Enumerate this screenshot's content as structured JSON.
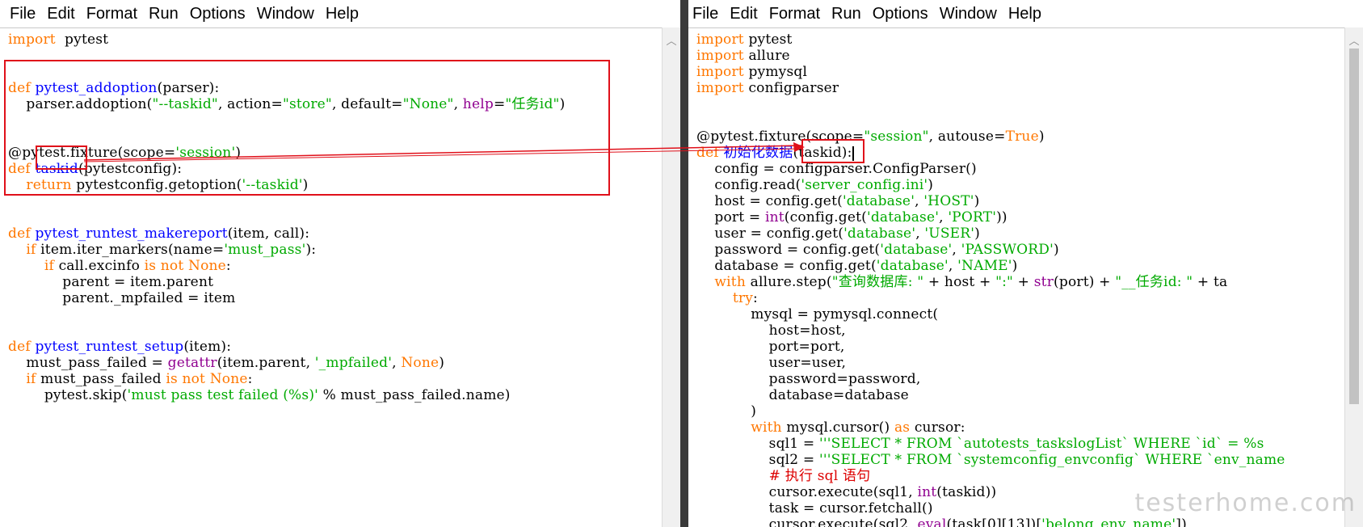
{
  "left_window": {
    "menu": [
      "File",
      "Edit",
      "Format",
      "Run",
      "Options",
      "Window",
      "Help"
    ],
    "code_lines": [
      [
        [
          "kw",
          "import"
        ],
        [
          "",
          "  pytest"
        ]
      ],
      [],
      [],
      [
        [
          "kw",
          "def"
        ],
        [
          "",
          " "
        ],
        [
          "def",
          "pytest_addoption"
        ],
        [
          "",
          "(parser):"
        ]
      ],
      [
        [
          "",
          "    parser.addoption("
        ],
        [
          "str",
          "\"--taskid\""
        ],
        [
          "",
          ", action="
        ],
        [
          "str",
          "\"store\""
        ],
        [
          "",
          ", default="
        ],
        [
          "str",
          "\"None\""
        ],
        [
          "",
          ", "
        ],
        [
          "bi",
          "help"
        ],
        [
          "",
          "="
        ],
        [
          "str",
          "\"任务id\""
        ],
        [
          "",
          ")"
        ]
      ],
      [],
      [],
      [
        [
          "",
          "@pytest.fixture(scope="
        ],
        [
          "str",
          "'session'"
        ],
        [
          "",
          ")"
        ]
      ],
      [
        [
          "kw",
          "def"
        ],
        [
          "",
          " "
        ],
        [
          "def",
          "taskid"
        ],
        [
          "",
          "(pytestconfig):"
        ]
      ],
      [
        [
          "",
          "    "
        ],
        [
          "kw",
          "return"
        ],
        [
          "",
          " pytestconfig.getoption("
        ],
        [
          "str",
          "'--taskid'"
        ],
        [
          "",
          ")"
        ]
      ],
      [],
      [],
      [
        [
          "kw",
          "def"
        ],
        [
          "",
          " "
        ],
        [
          "def",
          "pytest_runtest_makereport"
        ],
        [
          "",
          "(item, call):"
        ]
      ],
      [
        [
          "",
          "    "
        ],
        [
          "kw",
          "if"
        ],
        [
          "",
          " item.iter_markers(name="
        ],
        [
          "str",
          "'must_pass'"
        ],
        [
          "",
          "):"
        ]
      ],
      [
        [
          "",
          "        "
        ],
        [
          "kw",
          "if"
        ],
        [
          "",
          " call.excinfo "
        ],
        [
          "kw",
          "is not"
        ],
        [
          "",
          " "
        ],
        [
          "kw",
          "None"
        ],
        [
          "",
          ":"
        ]
      ],
      [
        [
          "",
          "            parent = item.parent"
        ]
      ],
      [
        [
          "",
          "            parent._mpfailed = item"
        ]
      ],
      [],
      [],
      [
        [
          "kw",
          "def"
        ],
        [
          "",
          " "
        ],
        [
          "def",
          "pytest_runtest_setup"
        ],
        [
          "",
          "(item):"
        ]
      ],
      [
        [
          "",
          "    must_pass_failed = "
        ],
        [
          "bi",
          "getattr"
        ],
        [
          "",
          "(item.parent, "
        ],
        [
          "str",
          "'_mpfailed'"
        ],
        [
          "",
          ", "
        ],
        [
          "kw",
          "None"
        ],
        [
          "",
          ")"
        ]
      ],
      [
        [
          "",
          "    "
        ],
        [
          "kw",
          "if"
        ],
        [
          "",
          " must_pass_failed "
        ],
        [
          "kw",
          "is not"
        ],
        [
          "",
          " "
        ],
        [
          "kw",
          "None"
        ],
        [
          "",
          ":"
        ]
      ],
      [
        [
          "",
          "        pytest.skip("
        ],
        [
          "str",
          "'must pass test failed (%s)'"
        ],
        [
          "",
          " % must_pass_failed.name)"
        ]
      ]
    ]
  },
  "right_window": {
    "menu": [
      "File",
      "Edit",
      "Format",
      "Run",
      "Options",
      "Window",
      "Help"
    ],
    "code_lines": [
      [
        [
          "kw",
          "import"
        ],
        [
          "",
          " pytest"
        ]
      ],
      [
        [
          "kw",
          "import"
        ],
        [
          "",
          " allure"
        ]
      ],
      [
        [
          "kw",
          "import"
        ],
        [
          "",
          " pymysql"
        ]
      ],
      [
        [
          "kw",
          "import"
        ],
        [
          "",
          " configparser"
        ]
      ],
      [],
      [],
      [
        [
          "",
          "@pytest.fixture(scope="
        ],
        [
          "str",
          "\"session\""
        ],
        [
          "",
          ", autouse="
        ],
        [
          "kw",
          "True"
        ],
        [
          "",
          ")"
        ]
      ],
      [
        [
          "kw",
          "def"
        ],
        [
          "",
          " "
        ],
        [
          "def",
          "初始化数据"
        ],
        [
          "",
          "(taskid):"
        ]
      ],
      [
        [
          "",
          "    config = configparser.ConfigParser()"
        ]
      ],
      [
        [
          "",
          "    config.read("
        ],
        [
          "str",
          "'server_config.ini'"
        ],
        [
          "",
          ")"
        ]
      ],
      [
        [
          "",
          "    host = config.get("
        ],
        [
          "str",
          "'database'"
        ],
        [
          "",
          ", "
        ],
        [
          "str",
          "'HOST'"
        ],
        [
          "",
          ")"
        ]
      ],
      [
        [
          "",
          "    port = "
        ],
        [
          "bi",
          "int"
        ],
        [
          "",
          "(config.get("
        ],
        [
          "str",
          "'database'"
        ],
        [
          "",
          ", "
        ],
        [
          "str",
          "'PORT'"
        ],
        [
          "",
          "))"
        ]
      ],
      [
        [
          "",
          "    user = config.get("
        ],
        [
          "str",
          "'database'"
        ],
        [
          "",
          ", "
        ],
        [
          "str",
          "'USER'"
        ],
        [
          "",
          ")"
        ]
      ],
      [
        [
          "",
          "    password = config.get("
        ],
        [
          "str",
          "'database'"
        ],
        [
          "",
          ", "
        ],
        [
          "str",
          "'PASSWORD'"
        ],
        [
          "",
          ")"
        ]
      ],
      [
        [
          "",
          "    database = config.get("
        ],
        [
          "str",
          "'database'"
        ],
        [
          "",
          ", "
        ],
        [
          "str",
          "'NAME'"
        ],
        [
          "",
          ")"
        ]
      ],
      [
        [
          "",
          "    "
        ],
        [
          "kw",
          "with"
        ],
        [
          "",
          " allure.step("
        ],
        [
          "str",
          "\"查询数据库: \""
        ],
        [
          "",
          " + host + "
        ],
        [
          "str",
          "\":\""
        ],
        [
          "",
          " + "
        ],
        [
          "bi",
          "str"
        ],
        [
          "",
          "(port) + "
        ],
        [
          "str",
          "\"__任务id: \""
        ],
        [
          "",
          " + ta"
        ]
      ],
      [
        [
          "",
          "        "
        ],
        [
          "kw",
          "try"
        ],
        [
          "",
          ":"
        ]
      ],
      [
        [
          "",
          "            mysql = pymysql.connect("
        ]
      ],
      [
        [
          "",
          "                host=host,"
        ]
      ],
      [
        [
          "",
          "                port=port,"
        ]
      ],
      [
        [
          "",
          "                user=user,"
        ]
      ],
      [
        [
          "",
          "                password=password,"
        ]
      ],
      [
        [
          "",
          "                database=database"
        ]
      ],
      [
        [
          "",
          "            )"
        ]
      ],
      [
        [
          "",
          "            "
        ],
        [
          "kw",
          "with"
        ],
        [
          "",
          " mysql.cursor() "
        ],
        [
          "kw",
          "as"
        ],
        [
          "",
          " cursor:"
        ]
      ],
      [
        [
          "",
          "                sql1 = "
        ],
        [
          "str",
          "'''SELECT * FROM `autotests_taskslogList` WHERE `id` = %s"
        ]
      ],
      [
        [
          "",
          "                sql2 = "
        ],
        [
          "str",
          "'''SELECT * FROM `systemconfig_envconfig` WHERE `env_name"
        ]
      ],
      [
        [
          "",
          "                "
        ],
        [
          "cm",
          "# 执行 sql 语句"
        ]
      ],
      [
        [
          "",
          "                cursor.execute(sql1, "
        ],
        [
          "bi",
          "int"
        ],
        [
          "",
          "(taskid))"
        ]
      ],
      [
        [
          "",
          "                task = cursor.fetchall()"
        ]
      ],
      [
        [
          "",
          "                cursor.execute(sql2, "
        ],
        [
          "bi",
          "eval"
        ],
        [
          "",
          "(task[0][13])["
        ],
        [
          "str",
          "'belong_env_name'"
        ],
        [
          "",
          "])"
        ]
      ]
    ],
    "watermark": "testerhome.com"
  },
  "colors": {
    "keyword": "#ff7700",
    "definition": "#0000ff",
    "string": "#00aa00",
    "builtin": "#900090",
    "comment": "#dd0000",
    "highlight": "#e0101a"
  }
}
